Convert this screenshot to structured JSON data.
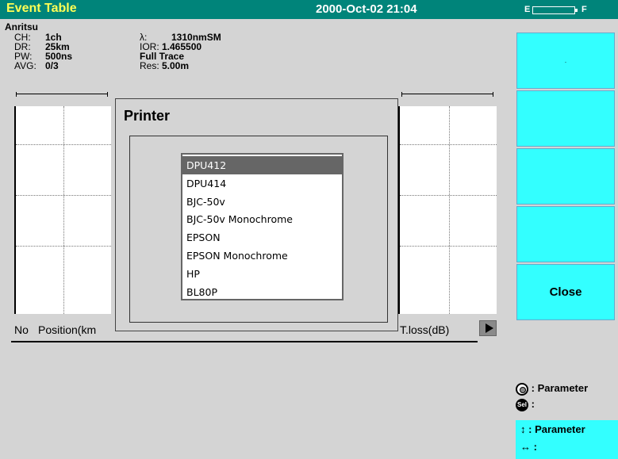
{
  "header": {
    "title": "Event Table",
    "datetime": "2000-Oct-02 21:04",
    "battery_empty": "E",
    "battery_full": "F"
  },
  "brand": "Anritsu",
  "params": {
    "ch_label": "CH:",
    "ch_value": "1ch",
    "dr_label": "DR:",
    "dr_value": "25km",
    "pw_label": "PW:",
    "pw_value": "500ns",
    "avg_label": "AVG:",
    "avg_value": "0/3",
    "wl_label": "λ:",
    "wl_value": "1310nmSM",
    "ior_label": "IOR:",
    "ior_value": "1.465500",
    "trace_value": "Full Trace",
    "res_label": "Res:",
    "res_value": "5.00m"
  },
  "table": {
    "col_no": "No",
    "col_position": "Position(km",
    "col_tloss": "T.loss(dB)"
  },
  "dialog": {
    "title": "Printer",
    "items": [
      "DPU412",
      "DPU414",
      "BJC-50v",
      "BJC-50v Monochrome",
      "EPSON",
      "EPSON Monochrome",
      "HP",
      "BL80P"
    ],
    "selected_index": 0
  },
  "softkeys": {
    "sk1": ".",
    "sk5": "Close"
  },
  "help": {
    "knob_text": ": Parameter",
    "sel_text": ":",
    "sel_glyph": "Sel",
    "updown_text": ": Parameter",
    "leftright_text": ":",
    "updown_glyph": "↕",
    "leftright_glyph": "↔"
  },
  "colors": {
    "title_bar": "#00847a",
    "title_text": "#ffff55",
    "softkey": "#33ffff",
    "selection": "#666666"
  }
}
